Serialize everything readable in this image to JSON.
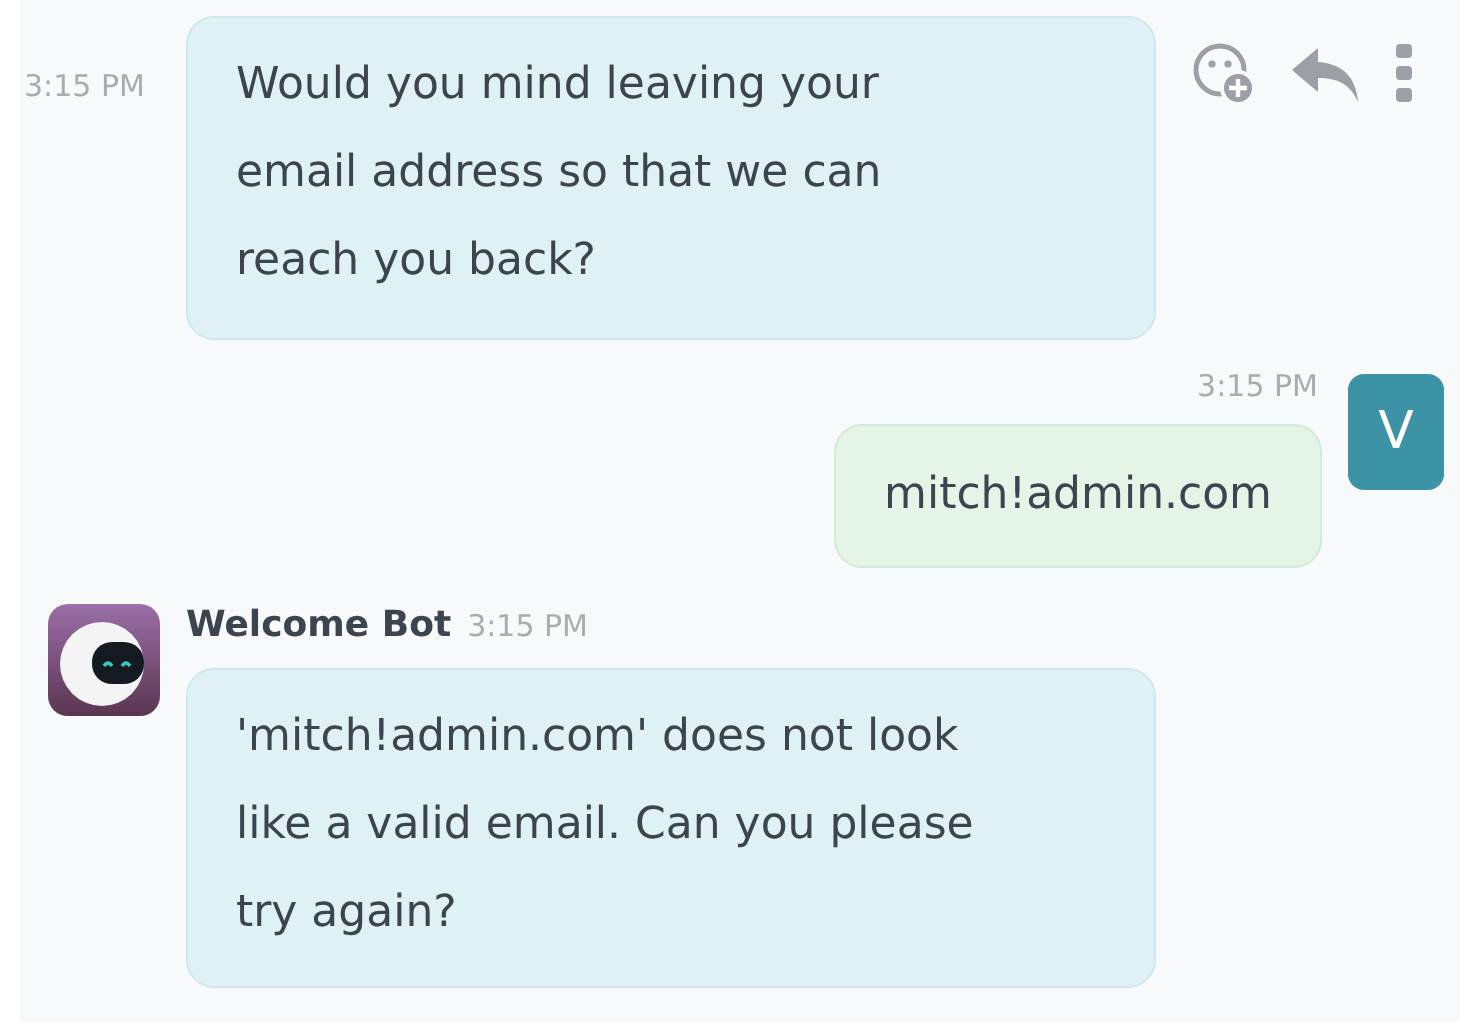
{
  "messages": [
    {
      "kind": "continued",
      "time": "3:15 PM",
      "text": "Would you mind leaving your email address so that we can reach you back?",
      "actions": true
    },
    {
      "kind": "self",
      "time": "3:15 PM",
      "avatar_letter": "V",
      "text": "mitch!admin.com"
    },
    {
      "kind": "bot",
      "author": "Welcome Bot",
      "time": "3:15 PM",
      "text": "'mitch!admin.com' does not look like a valid email. Can you please try again?"
    }
  ]
}
